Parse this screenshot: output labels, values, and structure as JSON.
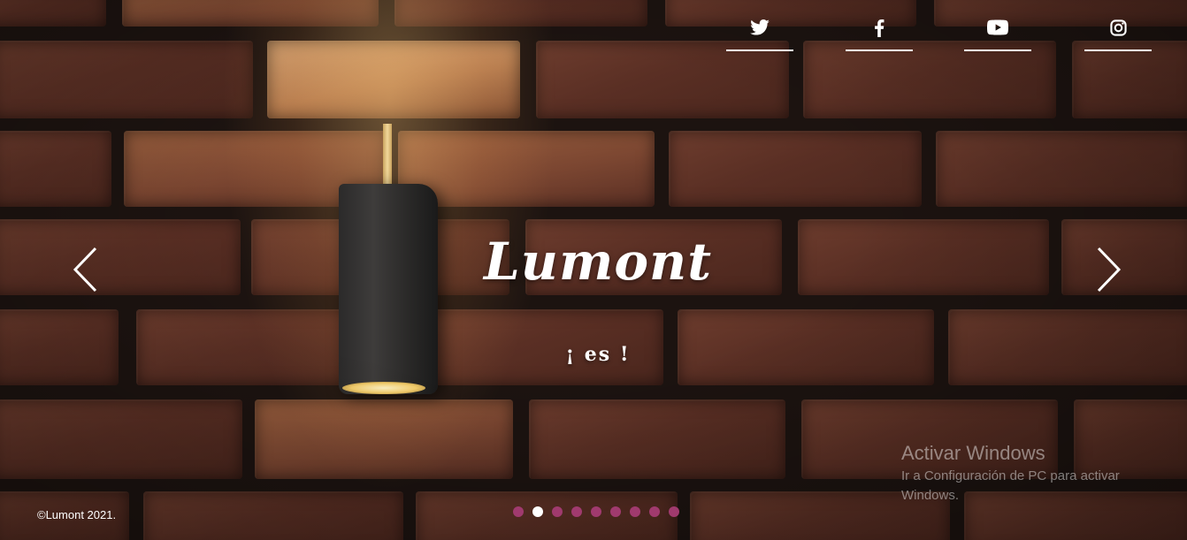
{
  "brand": {
    "title": "Lumont",
    "subtitle": "¡ es !"
  },
  "social": [
    {
      "icon": "twitter-icon"
    },
    {
      "icon": "facebook-icon"
    },
    {
      "icon": "youtube-icon"
    },
    {
      "icon": "instagram-icon"
    }
  ],
  "carousel": {
    "prev_icon": "chevron-left-icon",
    "next_icon": "chevron-right-icon",
    "slide_count": 9,
    "active_index": 1,
    "dot_color": "#a03a6e",
    "active_dot_color": "#ffffff"
  },
  "footer": {
    "copyright": "©Lumont 2021."
  },
  "os_watermark": {
    "title": "Activar Windows",
    "subtitle": "Ir a Configuración de PC para activar Windows."
  }
}
